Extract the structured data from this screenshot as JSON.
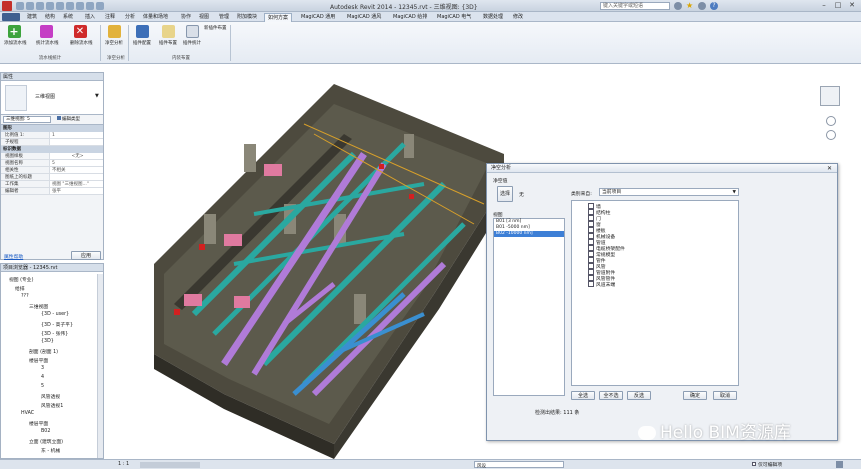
{
  "app": {
    "title": "Autodesk Revit 2014 - 12345.rvt - 三维视图: {3D}",
    "search_placeholder": "键入关键字或短语"
  },
  "menu": {
    "tabs": [
      "建筑",
      "结构",
      "系统",
      "插入",
      "注释",
      "分析",
      "体量和场地",
      "协作",
      "视图",
      "管理",
      "附加模块",
      "如何方案",
      "MagiCAD 通用",
      "MagiCAD 通风",
      "MagiCAD 给排",
      "MagiCAD 电气",
      "数据处理",
      "修改"
    ]
  },
  "ribbon": {
    "buttons": [
      "添加流水线",
      "统计流水线",
      "删除流水线",
      "净空分析",
      "插件配置",
      "插件布置",
      "插件统计"
    ],
    "groups": [
      "流水线统计",
      "净空分析",
      "内装布置"
    ],
    "extra_label": "新插件布置"
  },
  "properties": {
    "title": "属性",
    "type_name": "三维视图",
    "view_selector": "三维视图: 5",
    "edit_type": "编辑类型",
    "section_graphics": "图形",
    "rows_graphics": [
      {
        "k": "比例值 1:",
        "v": "1"
      },
      {
        "k": "子规程",
        "v": ""
      }
    ],
    "section_identity": "标识数据",
    "rows_identity": [
      {
        "k": "视图样板",
        "v": "<无>"
      },
      {
        "k": "视图名称",
        "v": "5"
      },
      {
        "k": "相关性",
        "v": "不相关"
      },
      {
        "k": "图纸上的标题",
        "v": ""
      },
      {
        "k": "工作集",
        "v": "视图 \"三维视图...\""
      },
      {
        "k": "编辑者",
        "v": "张平"
      }
    ],
    "help_link": "属性帮助",
    "apply_btn": "应用"
  },
  "browser": {
    "title": "项目浏览器 - 12345.rvt",
    "items": [
      "视图 (专业)",
      "给排",
      "???",
      "三维视图",
      "{3D - user}",
      "{3D - 高子平}",
      "{3D - 张伟}",
      "{3D}",
      "剖面 (剖面 1)",
      "楼层平面",
      "3",
      "4",
      "5",
      "风管透视",
      "风管透视1",
      "HVAC",
      "楼层平面",
      "B02",
      "立面 (建筑立面)",
      "东 - 机械"
    ]
  },
  "dialog": {
    "title": "净空分析",
    "left_header": "净空值",
    "unit_label": "无",
    "select_btn": "选择",
    "view_label": "视图",
    "view_rows": [
      "B01  [3 nm]",
      "B01  -5000 nm]",
      "B02  -10000 nm]"
    ],
    "filter_label": "类别来自:",
    "filter_value": "当前项目",
    "categories": [
      "墙",
      "结构柱",
      "门",
      "窗",
      "楼板",
      "机械设备",
      "管道",
      "电缆桥架配件",
      "常规模型",
      "管件",
      "风管",
      "管道附件",
      "风管管件",
      "风道末端"
    ],
    "btn_all": "全选",
    "btn_none": "全不选",
    "btn_invert": "反选",
    "btn_ok": "确定",
    "btn_cancel": "取消",
    "result_label": "检测出结果:",
    "result_value": "111 条"
  },
  "status": {
    "scale": "1 : 1",
    "workset": "风设",
    "main_model": "仅可编辑项"
  },
  "watermark": "Hello BIM资源库",
  "colors": {
    "pipe_cyan": "#2aa8a0",
    "pipe_purple": "#b07bd8",
    "pipe_blue": "#3a8fd0",
    "equip_pink": "#e07aa0",
    "red_mark": "#d22020",
    "walls": "#3a3a30",
    "floor": "#5a5a50"
  }
}
